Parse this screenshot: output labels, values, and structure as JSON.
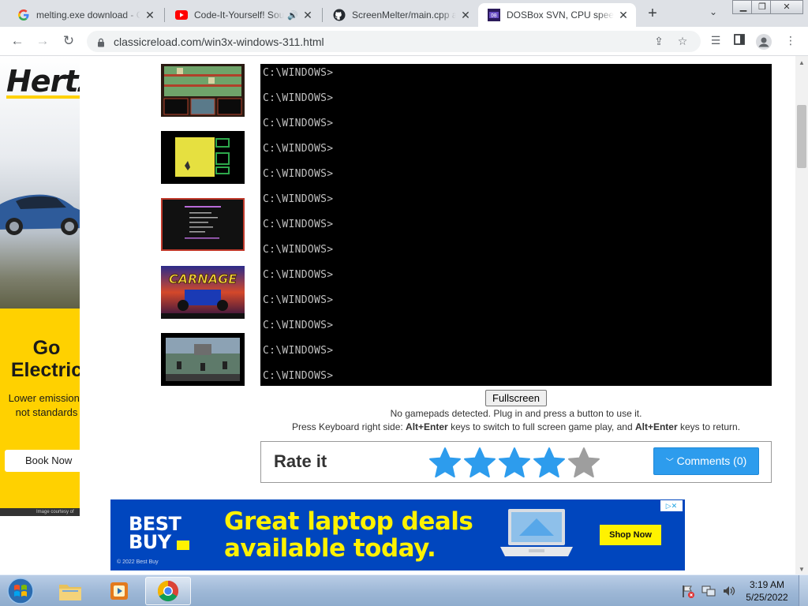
{
  "browser": {
    "tabs": [
      {
        "title": "melting.exe download - Co",
        "icon": "google-icon"
      },
      {
        "title": "Code-It-Yourself! Sou",
        "icon": "youtube-icon",
        "audio": "🔊"
      },
      {
        "title": "ScreenMelter/main.cpp at",
        "icon": "github-icon"
      },
      {
        "title": "DOSBox SVN, CPU speed:",
        "icon": "dosbox-icon",
        "active": true
      }
    ],
    "url": "classicreload.com/win3x-windows-311.html"
  },
  "hertz_ad": {
    "logo": "Hertz",
    "headline": "Go Electric",
    "subtext": "Lower emissions not standards",
    "cta": "Book Now",
    "courtesy": "Image courtesy of"
  },
  "dos": {
    "lines": [
      "C:\\WINDOWS>",
      "C:\\WINDOWS>",
      "C:\\WINDOWS>",
      "C:\\WINDOWS>",
      "C:\\WINDOWS>",
      "C:\\WINDOWS>",
      "C:\\WINDOWS>",
      "C:\\WINDOWS>",
      "C:\\WINDOWS>",
      "C:\\WINDOWS>",
      "C:\\WINDOWS>",
      "C:\\WINDOWS>",
      "C:\\WINDOWS>"
    ]
  },
  "emulator": {
    "fullscreen_label": "Fullscreen",
    "gamepad_msg": "No gamepads detected. Plug in and press a button to use it.",
    "keyboard_msg_1": "Press Keyboard right side: ",
    "keyboard_key_1": "Alt+Enter",
    "keyboard_msg_2": " keys to switch to full screen game play, and ",
    "keyboard_key_2": "Alt+Enter",
    "keyboard_msg_3": " keys to return."
  },
  "rating": {
    "title": "Rate it",
    "stars_filled": 4,
    "stars_total": 5,
    "comments_label": "Comments (0)"
  },
  "bestbuy_ad": {
    "logo_line1": "BEST",
    "logo_line2": "BUY",
    "headline_1": "Great laptop deals",
    "headline_2": "available today.",
    "cta": "Shop Now",
    "copyright": "© 2022 Best Buy"
  },
  "taskbar": {
    "time": "3:19 AM",
    "date": "5/25/2022"
  },
  "colors": {
    "star_filled": "#2d9ced",
    "star_empty": "#9e9e9e",
    "comments_btn": "#2d9ced",
    "bestbuy_blue": "#0046be",
    "bestbuy_yellow": "#fff200",
    "hertz_yellow": "#ffd100"
  }
}
